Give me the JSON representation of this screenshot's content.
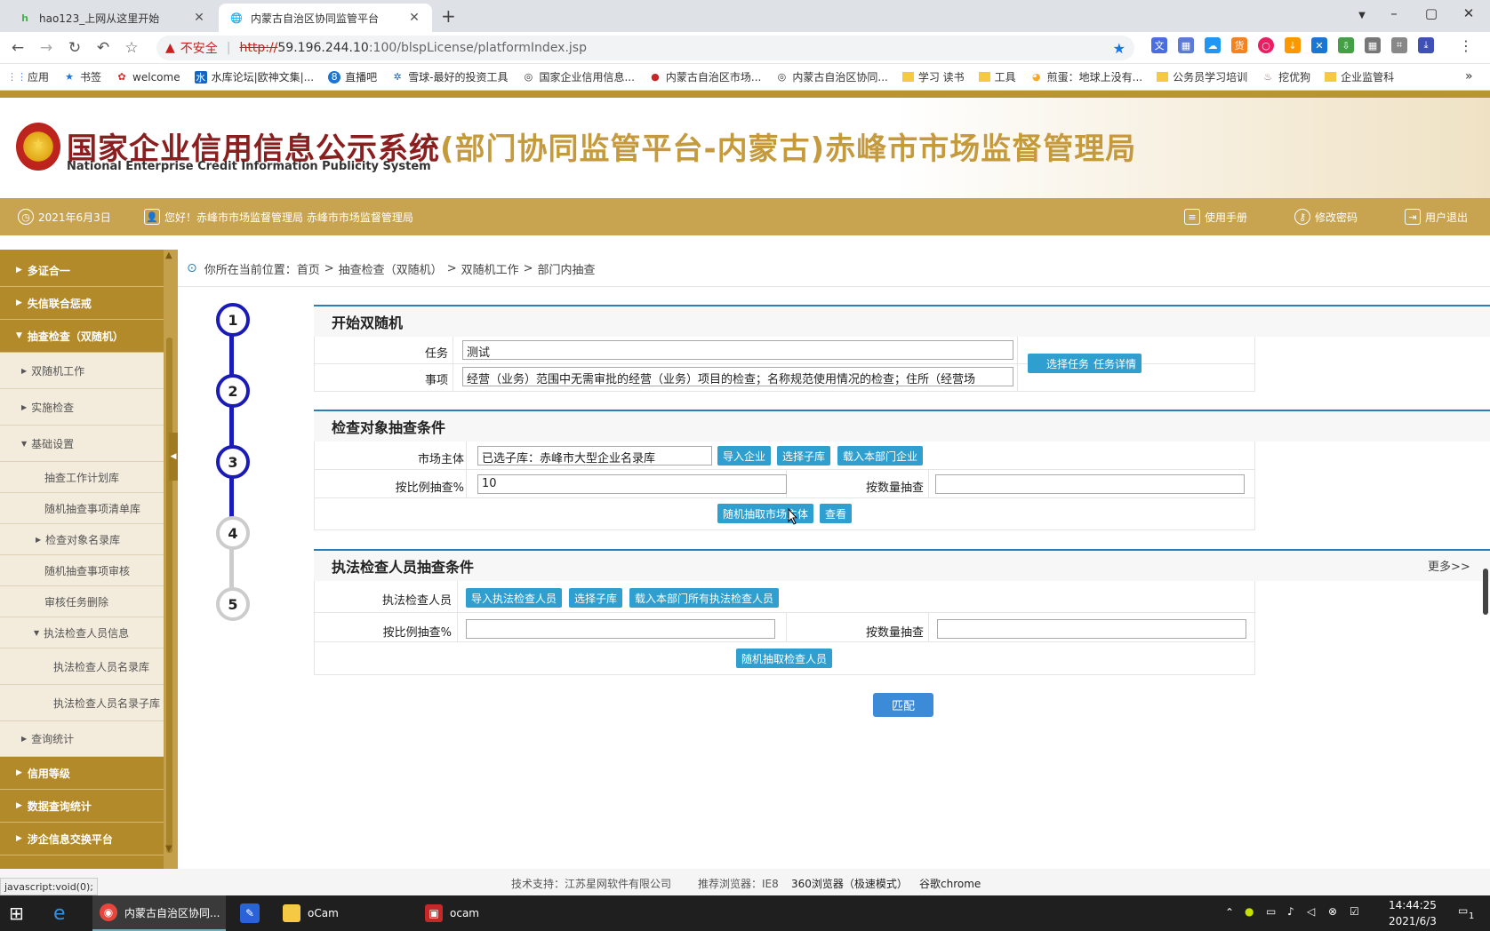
{
  "browser": {
    "tabs": [
      {
        "label": "hao123_上网从这里开始",
        "icon": "hao-icon"
      },
      {
        "label": "内蒙古自治区协同监管平台",
        "icon": "globe-icon"
      }
    ],
    "omnibox": {
      "insecure_label": "不安全",
      "proto": "http://",
      "host": "59.196.244.10",
      "path": ":100/blspLicense/platformIndex.jsp"
    },
    "bookmarks": [
      {
        "label": "应用",
        "icon": "apps-icon"
      },
      {
        "label": "书签",
        "icon": "star-icon"
      },
      {
        "label": "welcome",
        "icon": "huawei-icon"
      },
      {
        "label": "水库论坛|欧神文集|...",
        "icon": "water-icon"
      },
      {
        "label": "直播吧",
        "icon": "live-icon"
      },
      {
        "label": "雪球-最好的投资工具",
        "icon": "snowball-icon"
      },
      {
        "label": "国家企业信用信息...",
        "icon": "globe-icon"
      },
      {
        "label": "内蒙古自治区市场...",
        "icon": "emblem-icon"
      },
      {
        "label": "内蒙古自治区协同...",
        "icon": "globe-icon"
      },
      {
        "label": "学习 读书",
        "icon": "folder-icon"
      },
      {
        "label": "工具",
        "icon": "folder-icon"
      },
      {
        "label": "煎蛋：地球上没有...",
        "icon": "chick-icon"
      },
      {
        "label": "公务员学习培训",
        "icon": "folder-icon"
      },
      {
        "label": "挖优狗",
        "icon": "dog-icon"
      },
      {
        "label": "企业监管科",
        "icon": "folder-icon"
      }
    ],
    "bookmarks_more": "»"
  },
  "header": {
    "title_main": "国家企业信用信息公示系统",
    "title_sub": "(部门协同监管平台-内蒙古)赤峰市市场监督管理局",
    "title_en": "National Enterprise Credit Information Publicity System",
    "date": "2021年6月3日",
    "greeting": "您好！赤峰市市场监督管理局 赤峰市市场监督管理局",
    "links": {
      "manual": "使用手册",
      "change_password": "修改密码",
      "logout": "用户退出"
    }
  },
  "sidebar": {
    "groups": [
      {
        "label": "多证合一"
      },
      {
        "label": "失信联合惩戒"
      },
      {
        "label": "抽查检查（双随机）"
      }
    ],
    "sub": [
      {
        "label": "双随机工作"
      },
      {
        "label": "实施检查"
      },
      {
        "label": "基础设置"
      },
      {
        "label": "抽查工作计划库"
      },
      {
        "label": "随机抽查事项清单库"
      },
      {
        "label": "检查对象名录库"
      },
      {
        "label": "随机抽查事项审核"
      },
      {
        "label": "审核任务删除"
      },
      {
        "label": "执法检查人员信息"
      },
      {
        "label": "执法检查人员名录库"
      },
      {
        "label": "执法检查人员名录子库"
      },
      {
        "label": "查询统计"
      }
    ],
    "bottom": [
      {
        "label": "信用等级"
      },
      {
        "label": "数据查询统计"
      },
      {
        "label": "涉企信息交换平台"
      }
    ]
  },
  "breadcrumb": {
    "prefix": "你所在当前位置：",
    "items": [
      "首页",
      "抽查检查（双随机）",
      "双随机工作",
      "部门内抽查"
    ],
    "sep": ">"
  },
  "steps": [
    "1",
    "2",
    "3",
    "4",
    "5"
  ],
  "section1": {
    "title": "开始双随机",
    "task_label": "任务",
    "task_value": "测试",
    "item_label": "事项",
    "item_value": "经营（业务）范围中无需审批的经营（业务）项目的检查；名称规范使用情况的检查；住所（经营场",
    "btn_select_task": "选择任务",
    "btn_task_detail": "任务详情"
  },
  "section2": {
    "title": "检查对象抽查条件",
    "market_label": "市场主体",
    "market_value": "已选子库：赤峰市大型企业名录库",
    "btn_import": "导入企业",
    "btn_select_sub": "选择子库",
    "btn_load_dept": "载入本部门企业",
    "ratio_label": "按比例抽查%",
    "ratio_value": "10",
    "count_label": "按数量抽查",
    "count_value": "",
    "btn_random": "随机抽取市场主体",
    "btn_view": "查看"
  },
  "section3": {
    "title": "执法检查人员抽查条件",
    "more": "更多>>",
    "staff_label": "执法检查人员",
    "btn_import_staff": "导入执法检查人员",
    "btn_select_sub": "选择子库",
    "btn_load_all": "载入本部门所有执法检查人员",
    "ratio_label": "按比例抽查%",
    "ratio_value": "",
    "count_label": "按数量抽查",
    "count_value": "",
    "btn_random_staff": "随机抽取检查人员"
  },
  "match_button": "匹配",
  "footer": {
    "support": "技术支持：江苏星网软件有限公司",
    "browser_label": "推荐浏览器：IE8",
    "browser_360": "360浏览器（极速模式）",
    "browser_chrome": "谷歌chrome"
  },
  "status_url": "javascript:void(0);",
  "taskbar": {
    "items": [
      {
        "label": "内蒙古自治区协同...",
        "icon": "chrome-icon"
      },
      {
        "label": "oCam",
        "icon": "folder-icon"
      },
      {
        "label": "ocam",
        "icon": "ocam-icon"
      }
    ],
    "time": "14:44:25",
    "date": "2021/6/3",
    "notify_count": "1"
  }
}
